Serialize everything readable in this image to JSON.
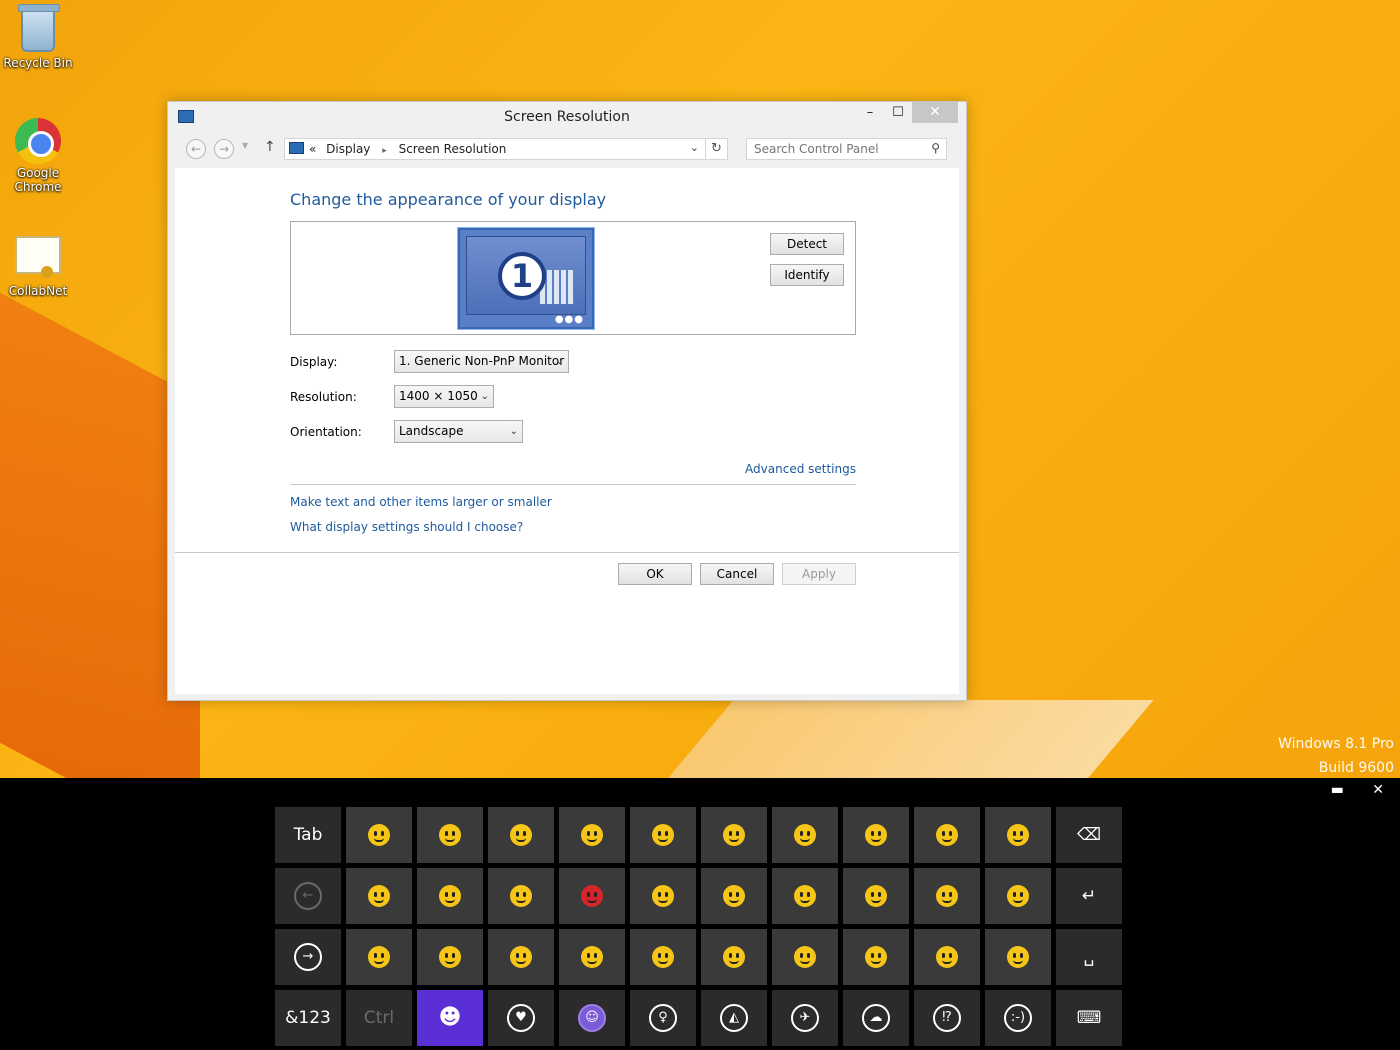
{
  "desktop": {
    "icons": [
      {
        "label": "Recycle Bin"
      },
      {
        "label": "Google Chrome"
      },
      {
        "label": "CollabNet"
      }
    ],
    "watermark": {
      "line1": "Windows 8.1 Pro",
      "line2": "Build 9600"
    }
  },
  "window": {
    "title": "Screen Resolution",
    "controls": {
      "minimize": "–",
      "maximize": "☐",
      "close": "✕"
    },
    "nav": {
      "back": "←",
      "forward": "→",
      "up": "↑"
    },
    "breadcrumb": {
      "prefix": "«",
      "items": [
        "Display",
        "Screen Resolution"
      ],
      "separator": "▸"
    },
    "search": {
      "placeholder": "Search Control Panel"
    },
    "heading": "Change the appearance of your display",
    "monitor_number": "1",
    "buttons": {
      "detect": "Detect",
      "identify": "Identify",
      "ok": "OK",
      "cancel": "Cancel",
      "apply": "Apply"
    },
    "fields": {
      "display": {
        "label": "Display:",
        "value": "1. Generic Non-PnP Monitor"
      },
      "resolution": {
        "label": "Resolution:",
        "value": "1400 × 1050"
      },
      "orientation": {
        "label": "Orientation:",
        "value": "Landscape"
      }
    },
    "links": {
      "advanced": "Advanced settings",
      "text_size": "Make text and other items larger or smaller",
      "help": "What display settings should I choose?"
    }
  },
  "keyboard": {
    "top_controls": {
      "dock": "▬",
      "close": "✕"
    },
    "row1": {
      "first": "Tab",
      "last": "⌫"
    },
    "row2": {
      "first": "←",
      "last": "↵"
    },
    "row3": {
      "first": "→",
      "last": "␣"
    },
    "row4": {
      "first": "&123",
      "ctrl": "Ctrl",
      "last": "⌨"
    },
    "category_icons": [
      "smiley-icon",
      "heart-icon",
      "face-icon",
      "balloon-icon",
      "pizza-icon",
      "airplane-icon",
      "weather-icon",
      "symbols-icon",
      "emoticon-text-icon"
    ]
  }
}
